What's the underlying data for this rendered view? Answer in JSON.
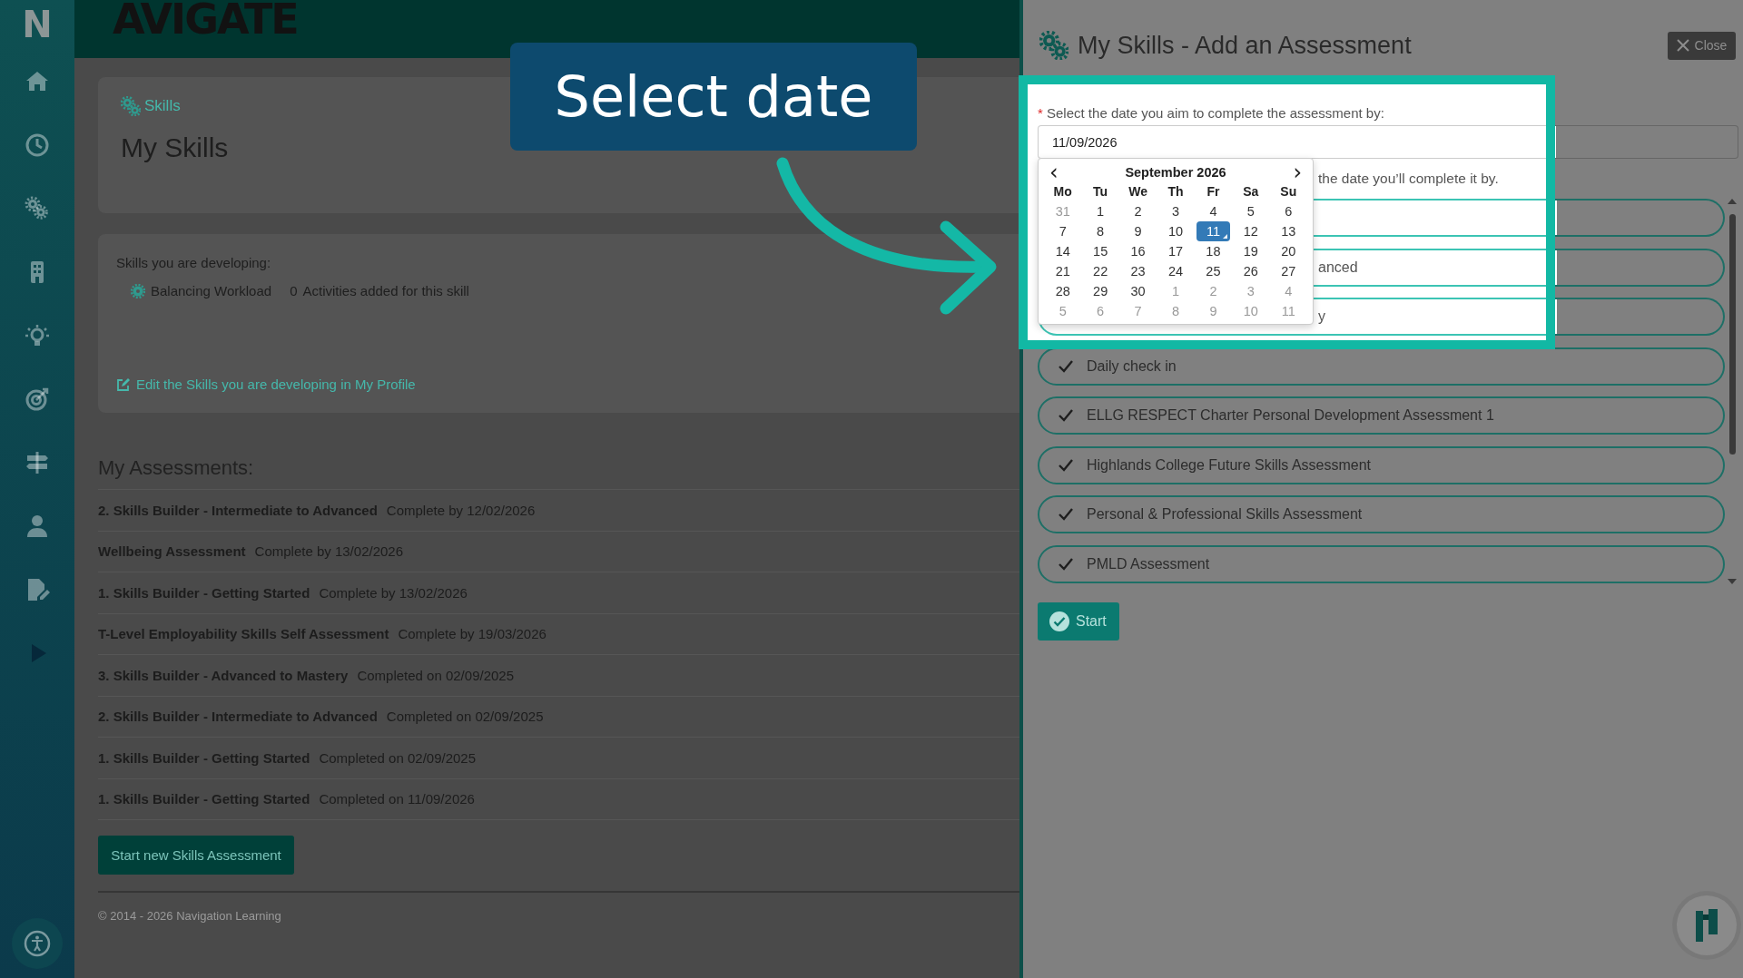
{
  "sidebar": {
    "logo_letter": "N"
  },
  "header": {
    "logo": "AVIGATE"
  },
  "skills_card": {
    "breadcrumb": "Skills",
    "title": "My Skills"
  },
  "developing": {
    "heading": "Skills you are developing:",
    "skills": [
      {
        "name": "Balancing Workload",
        "count": "0",
        "count_label": "Activities added for this skill"
      }
    ],
    "edit_link": "Edit the Skills you are developing in My Profile"
  },
  "assessments": {
    "heading": "My Assessments:",
    "rows": [
      {
        "name": "2. Skills Builder - Intermediate to Advanced",
        "status": "Complete by 12/02/2026"
      },
      {
        "name": "Wellbeing Assessment",
        "status": "Complete by 13/02/2026"
      },
      {
        "name": "1. Skills Builder - Getting Started",
        "status": "Complete by 13/02/2026"
      },
      {
        "name": "T-Level Employability Skills Self Assessment",
        "status": "Complete by 19/03/2026"
      },
      {
        "name": "3. Skills Builder - Advanced to Mastery",
        "status": "Completed on 02/09/2025"
      },
      {
        "name": "2. Skills Builder - Intermediate to Advanced",
        "status": "Completed on 02/09/2025"
      },
      {
        "name": "1. Skills Builder - Getting Started",
        "status": "Completed on 02/09/2025"
      },
      {
        "name": "1. Skills Builder - Getting Started",
        "status": "Completed on 11/09/2026"
      }
    ],
    "start_button": "Start new Skills Assessment"
  },
  "footer": "© 2014 - 2026 Navigation Learning",
  "panel": {
    "title": "My Skills - Add an Assessment",
    "close": "Close",
    "required_mark": "*",
    "date_label": "Select the date you aim to complete the assessment by:",
    "date_value": "11/09/2026",
    "hint_fragment": "the date you’ll complete it by.",
    "options": [
      {
        "kind": "covered"
      },
      {
        "kind": "fragment",
        "label": "anced"
      },
      {
        "kind": "fragment",
        "label": "y"
      },
      {
        "kind": "item",
        "label": "Daily check in"
      },
      {
        "kind": "item",
        "label": "ELLG RESPECT Charter Personal Development Assessment 1"
      },
      {
        "kind": "item",
        "label": "Highlands College Future Skills Assessment"
      },
      {
        "kind": "item",
        "label": "Personal & Professional Skills Assessment"
      },
      {
        "kind": "item",
        "label": "PMLD Assessment"
      }
    ],
    "start": "Start"
  },
  "calendar": {
    "month": "September 2026",
    "prev": "‹",
    "next": "›",
    "weekdays": [
      "Mo",
      "Tu",
      "We",
      "Th",
      "Fr",
      "Sa",
      "Su"
    ],
    "days": [
      {
        "day": "31",
        "muted": true,
        "selected": false
      },
      {
        "day": "1",
        "muted": false,
        "selected": false
      },
      {
        "day": "2",
        "muted": false,
        "selected": false
      },
      {
        "day": "3",
        "muted": false,
        "selected": false
      },
      {
        "day": "4",
        "muted": false,
        "selected": false
      },
      {
        "day": "5",
        "muted": false,
        "selected": false
      },
      {
        "day": "6",
        "muted": false,
        "selected": false
      },
      {
        "day": "7",
        "muted": false,
        "selected": false
      },
      {
        "day": "8",
        "muted": false,
        "selected": false
      },
      {
        "day": "9",
        "muted": false,
        "selected": false
      },
      {
        "day": "10",
        "muted": false,
        "selected": false
      },
      {
        "day": "11",
        "muted": false,
        "selected": true
      },
      {
        "day": "12",
        "muted": false,
        "selected": false
      },
      {
        "day": "13",
        "muted": false,
        "selected": false
      },
      {
        "day": "14",
        "muted": false,
        "selected": false
      },
      {
        "day": "15",
        "muted": false,
        "selected": false
      },
      {
        "day": "16",
        "muted": false,
        "selected": false
      },
      {
        "day": "17",
        "muted": false,
        "selected": false
      },
      {
        "day": "18",
        "muted": false,
        "selected": false
      },
      {
        "day": "19",
        "muted": false,
        "selected": false
      },
      {
        "day": "20",
        "muted": false,
        "selected": false
      },
      {
        "day": "21",
        "muted": false,
        "selected": false
      },
      {
        "day": "22",
        "muted": false,
        "selected": false
      },
      {
        "day": "23",
        "muted": false,
        "selected": false
      },
      {
        "day": "24",
        "muted": false,
        "selected": false
      },
      {
        "day": "25",
        "muted": false,
        "selected": false
      },
      {
        "day": "26",
        "muted": false,
        "selected": false
      },
      {
        "day": "27",
        "muted": false,
        "selected": false
      },
      {
        "day": "28",
        "muted": false,
        "selected": false
      },
      {
        "day": "29",
        "muted": false,
        "selected": false
      },
      {
        "day": "30",
        "muted": false,
        "selected": false
      },
      {
        "day": "1",
        "muted": true,
        "selected": false
      },
      {
        "day": "2",
        "muted": true,
        "selected": false
      },
      {
        "day": "3",
        "muted": true,
        "selected": false
      },
      {
        "day": "4",
        "muted": true,
        "selected": false
      },
      {
        "day": "5",
        "muted": true,
        "selected": false
      },
      {
        "day": "6",
        "muted": true,
        "selected": false
      },
      {
        "day": "7",
        "muted": true,
        "selected": false
      },
      {
        "day": "8",
        "muted": true,
        "selected": false
      },
      {
        "day": "9",
        "muted": true,
        "selected": false
      },
      {
        "day": "10",
        "muted": true,
        "selected": false
      },
      {
        "day": "11",
        "muted": true,
        "selected": false
      }
    ]
  },
  "tutorial": {
    "callout": "Select date"
  }
}
